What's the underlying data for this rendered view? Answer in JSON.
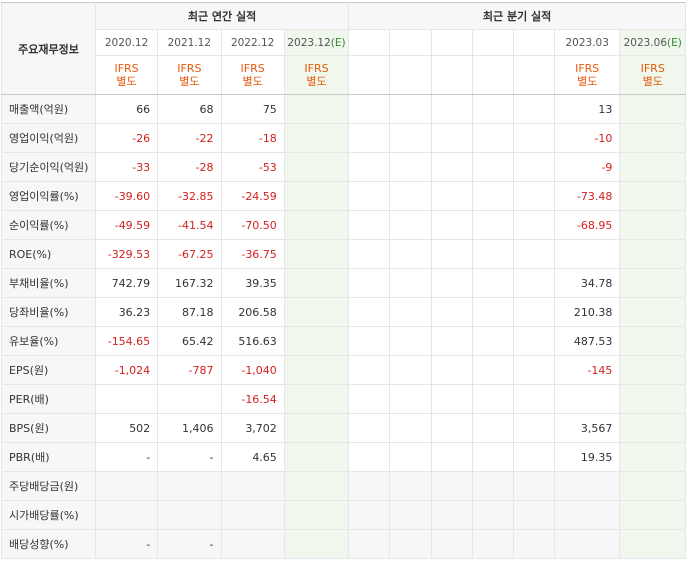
{
  "header": {
    "corner_label": "주요재무정보",
    "annual_label": "최근 연간 실적",
    "quarter_label": "최근 분기 실적",
    "annual_periods": [
      "2020.12",
      "2021.12",
      "2022.12",
      "2023.12"
    ],
    "annual_estimate_mark": "(E)",
    "quarter_periods": [
      "",
      "",
      "",
      "",
      "",
      "2023.03",
      "2023.06"
    ],
    "quarter_estimate_mark": "(E)",
    "ifrs_line1": "IFRS",
    "ifrs_line2": "별도"
  },
  "rows": [
    {
      "label": "매출액(억원)",
      "annual": [
        "66",
        "68",
        "75",
        ""
      ],
      "quarter": [
        "",
        "",
        "",
        "",
        "",
        "13",
        ""
      ]
    },
    {
      "label": "영업이익(억원)",
      "annual": [
        "-26",
        "-22",
        "-18",
        ""
      ],
      "quarter": [
        "",
        "",
        "",
        "",
        "",
        "-10",
        ""
      ]
    },
    {
      "label": "당기순이익(억원)",
      "annual": [
        "-33",
        "-28",
        "-53",
        ""
      ],
      "quarter": [
        "",
        "",
        "",
        "",
        "",
        "-9",
        ""
      ]
    },
    {
      "label": "영업이익률(%)",
      "annual": [
        "-39.60",
        "-32.85",
        "-24.59",
        ""
      ],
      "quarter": [
        "",
        "",
        "",
        "",
        "",
        "-73.48",
        ""
      ]
    },
    {
      "label": "순이익률(%)",
      "annual": [
        "-49.59",
        "-41.54",
        "-70.50",
        ""
      ],
      "quarter": [
        "",
        "",
        "",
        "",
        "",
        "-68.95",
        ""
      ]
    },
    {
      "label": "ROE(%)",
      "annual": [
        "-329.53",
        "-67.25",
        "-36.75",
        ""
      ],
      "quarter": [
        "",
        "",
        "",
        "",
        "",
        "",
        ""
      ]
    },
    {
      "label": "부채비율(%)",
      "annual": [
        "742.79",
        "167.32",
        "39.35",
        ""
      ],
      "quarter": [
        "",
        "",
        "",
        "",
        "",
        "34.78",
        ""
      ]
    },
    {
      "label": "당좌비율(%)",
      "annual": [
        "36.23",
        "87.18",
        "206.58",
        ""
      ],
      "quarter": [
        "",
        "",
        "",
        "",
        "",
        "210.38",
        ""
      ]
    },
    {
      "label": "유보율(%)",
      "annual": [
        "-154.65",
        "65.42",
        "516.63",
        ""
      ],
      "quarter": [
        "",
        "",
        "",
        "",
        "",
        "487.53",
        ""
      ]
    },
    {
      "label": "EPS(원)",
      "annual": [
        "-1,024",
        "-787",
        "-1,040",
        ""
      ],
      "quarter": [
        "",
        "",
        "",
        "",
        "",
        "-145",
        ""
      ]
    },
    {
      "label": "PER(배)",
      "annual": [
        "",
        "",
        "-16.54",
        ""
      ],
      "quarter": [
        "",
        "",
        "",
        "",
        "",
        "",
        ""
      ]
    },
    {
      "label": "BPS(원)",
      "annual": [
        "502",
        "1,406",
        "3,702",
        ""
      ],
      "quarter": [
        "",
        "",
        "",
        "",
        "",
        "3,567",
        ""
      ]
    },
    {
      "label": "PBR(배)",
      "annual": [
        "-",
        "-",
        "4.65",
        ""
      ],
      "quarter": [
        "",
        "",
        "",
        "",
        "",
        "19.35",
        ""
      ]
    },
    {
      "label": "주당배당금(원)",
      "annual": [
        "",
        "",
        "",
        ""
      ],
      "quarter": [
        "",
        "",
        "",
        "",
        "",
        "",
        ""
      ]
    },
    {
      "label": "시가배당률(%)",
      "annual": [
        "",
        "",
        "",
        ""
      ],
      "quarter": [
        "",
        "",
        "",
        "",
        "",
        "",
        ""
      ]
    },
    {
      "label": "배당성향(%)",
      "annual": [
        "-",
        "-",
        "",
        ""
      ],
      "quarter": [
        "",
        "",
        "",
        "",
        "",
        "",
        ""
      ]
    }
  ]
}
